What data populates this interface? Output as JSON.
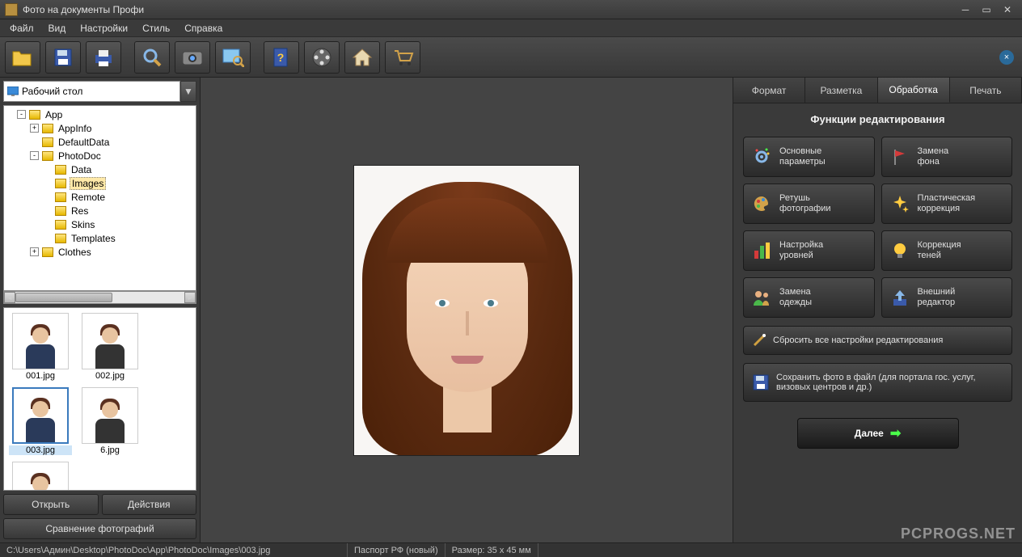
{
  "window": {
    "title": "Фото на документы Профи"
  },
  "menu": [
    "Файл",
    "Вид",
    "Настройки",
    "Стиль",
    "Справка"
  ],
  "toolbar_icons": [
    "open-folder",
    "save",
    "print",
    "zoom",
    "camera",
    "image-search",
    "help-book",
    "film-reel",
    "home",
    "cart"
  ],
  "path_selector": "Рабочий стол",
  "tree": [
    {
      "depth": 1,
      "toggle": "-",
      "label": "App"
    },
    {
      "depth": 2,
      "toggle": "+",
      "label": "AppInfo"
    },
    {
      "depth": 2,
      "toggle": "",
      "label": "DefaultData"
    },
    {
      "depth": 2,
      "toggle": "-",
      "label": "PhotoDoc"
    },
    {
      "depth": 3,
      "toggle": "",
      "label": "Data"
    },
    {
      "depth": 3,
      "toggle": "",
      "label": "Images",
      "selected": true
    },
    {
      "depth": 3,
      "toggle": "",
      "label": "Remote"
    },
    {
      "depth": 3,
      "toggle": "",
      "label": "Res"
    },
    {
      "depth": 3,
      "toggle": "",
      "label": "Skins"
    },
    {
      "depth": 3,
      "toggle": "",
      "label": "Templates"
    },
    {
      "depth": 2,
      "toggle": "+",
      "label": "Clothes"
    }
  ],
  "thumbs": [
    {
      "label": "001.jpg",
      "selected": false
    },
    {
      "label": "002.jpg",
      "selected": false
    },
    {
      "label": "003.jpg",
      "selected": true
    },
    {
      "label": "6.jpg",
      "selected": false
    },
    {
      "label": "",
      "selected": false
    }
  ],
  "sidebar_buttons": {
    "open": "Открыть",
    "actions": "Действия",
    "compare": "Сравнение фотографий"
  },
  "tabs": [
    {
      "label": "Формат",
      "active": false
    },
    {
      "label": "Разметка",
      "active": false
    },
    {
      "label": "Обработка",
      "active": true
    },
    {
      "label": "Печать",
      "active": false
    }
  ],
  "panel": {
    "title": "Функции редактирования",
    "buttons": [
      {
        "line1": "Основные",
        "line2": "параметры",
        "icon": "gear"
      },
      {
        "line1": "Замена",
        "line2": "фона",
        "icon": "flag"
      },
      {
        "line1": "Ретушь",
        "line2": "фотографии",
        "icon": "palette"
      },
      {
        "line1": "Пластическая",
        "line2": "коррекция",
        "icon": "sparkle"
      },
      {
        "line1": "Настройка",
        "line2": "уровней",
        "icon": "bars"
      },
      {
        "line1": "Коррекция",
        "line2": "теней",
        "icon": "bulb"
      },
      {
        "line1": "Замена",
        "line2": "одежды",
        "icon": "people"
      },
      {
        "line1": "Внешний",
        "line2": "редактор",
        "icon": "upload"
      }
    ],
    "reset": "Сбросить все настройки редактирования",
    "save": "Сохранить фото в файл (для портала гос. услуг, визовых центров и др.)",
    "next": "Далее"
  },
  "status": {
    "path": "C:\\Users\\Админ\\Desktop\\PhotoDoc\\App\\PhotoDoc\\Images\\003.jpg",
    "format": "Паспорт РФ (новый)",
    "size": "Размер: 35 x 45 мм"
  },
  "watermark": "PCPROGS.NET"
}
